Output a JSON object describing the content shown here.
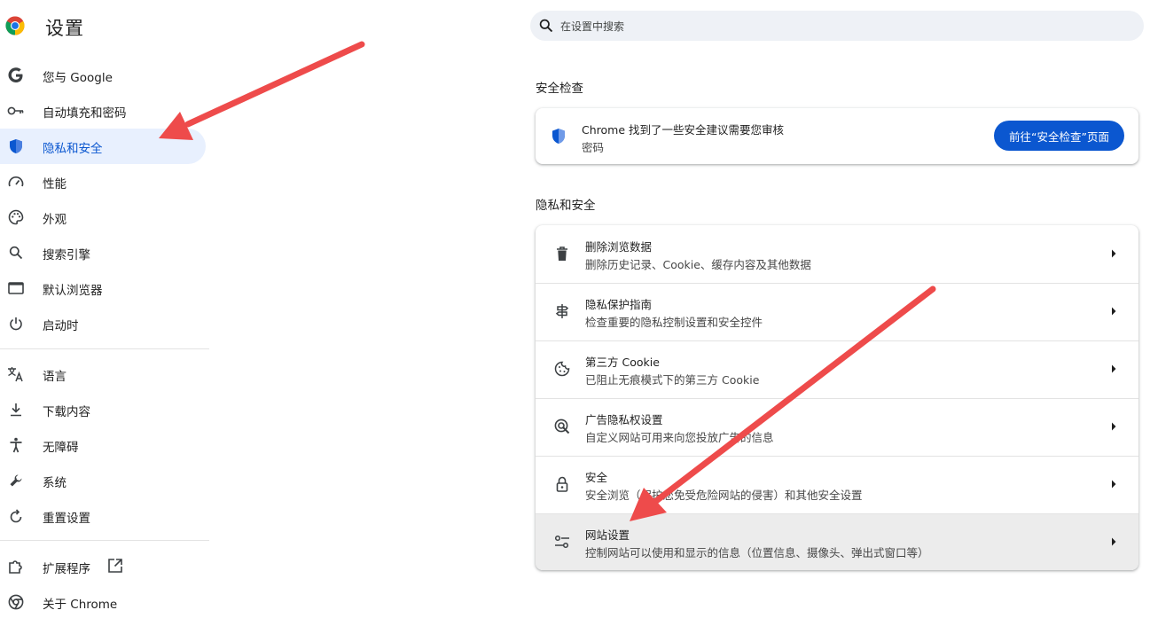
{
  "app": {
    "title": "设置"
  },
  "sidebar": {
    "items": [
      {
        "label": "您与 Google",
        "icon": "google-g-icon"
      },
      {
        "label": "自动填充和密码",
        "icon": "key-icon"
      },
      {
        "label": "隐私和安全",
        "icon": "shield-icon",
        "active": true
      },
      {
        "label": "性能",
        "icon": "speedometer-icon"
      },
      {
        "label": "外观",
        "icon": "palette-icon"
      },
      {
        "label": "搜索引擎",
        "icon": "search-icon"
      },
      {
        "label": "默认浏览器",
        "icon": "browser-window-icon"
      },
      {
        "label": "启动时",
        "icon": "power-icon"
      },
      {
        "label": "语言",
        "icon": "translate-icon"
      },
      {
        "label": "下载内容",
        "icon": "download-icon"
      },
      {
        "label": "无障碍",
        "icon": "accessibility-icon"
      },
      {
        "label": "系统",
        "icon": "wrench-icon"
      },
      {
        "label": "重置设置",
        "icon": "reset-icon"
      },
      {
        "label": "扩展程序",
        "icon": "puzzle-icon"
      },
      {
        "label": "关于 Chrome",
        "icon": "chrome-icon"
      }
    ]
  },
  "search": {
    "placeholder": "在设置中搜索"
  },
  "safety_check": {
    "section_title": "安全检查",
    "message": "Chrome 找到了一些安全建议需要您审核",
    "detail": "密码",
    "button_label": "前往“安全检查”页面"
  },
  "privacy": {
    "section_title": "隐私和安全",
    "rows": [
      {
        "title": "删除浏览数据",
        "subtitle": "删除历史记录、Cookie、缓存内容及其他数据",
        "icon": "trash-icon"
      },
      {
        "title": "隐私保护指南",
        "subtitle": "检查重要的隐私控制设置和安全控件",
        "icon": "signpost-icon"
      },
      {
        "title": "第三方 Cookie",
        "subtitle": "已阻止无痕模式下的第三方 Cookie",
        "icon": "cookie-icon"
      },
      {
        "title": "广告隐私权设置",
        "subtitle": "自定义网站可用来向您投放广告的信息",
        "icon": "ad-privacy-icon"
      },
      {
        "title": "安全",
        "subtitle": "安全浏览（保护您免受危险网站的侵害）和其他安全设置",
        "icon": "lock-icon"
      },
      {
        "title": "网站设置",
        "subtitle": "控制网站可以使用和显示的信息（位置信息、摄像头、弹出式窗口等）",
        "icon": "tune-icon",
        "highlighted": true
      }
    ]
  },
  "colors": {
    "accent": "#0b57d0",
    "active_bg": "#e8f0fe",
    "annotation_arrow": "#ee4b4b"
  }
}
